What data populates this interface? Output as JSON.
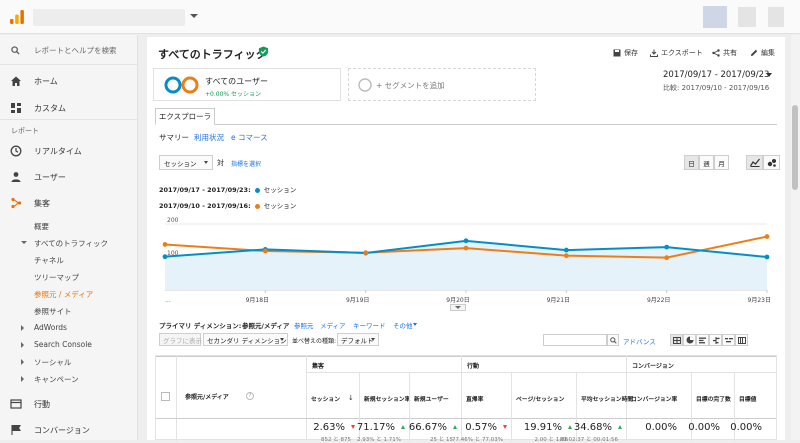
{
  "sidebar": {
    "search_placeholder": "レポートとヘルプを検索",
    "home": "ホーム",
    "custom": "カスタム",
    "reports_header": "レポート",
    "realtime": "リアルタイム",
    "audience": "ユーザー",
    "acquisition": "集客",
    "overview": "概要",
    "all_traffic": "すべてのトラフィック",
    "channels": "チャネル",
    "treemap": "ツリーマップ",
    "source_medium": "参照元 / メディア",
    "referrals": "参照サイト",
    "adwords": "AdWords",
    "search_console": "Search Console",
    "social": "ソーシャル",
    "campaigns": "キャンペーン",
    "behavior": "行動",
    "conversions": "コンバージョン"
  },
  "header": {
    "title": "すべてのトラフィック",
    "save": "保存",
    "export": "エクスポート",
    "share": "共有",
    "edit": "編集"
  },
  "segments": {
    "active_name": "すべてのユーザー",
    "active_pct": "+0.00% セッション",
    "add_label": "+ セグメントを追加"
  },
  "daterange": {
    "current": "2017/09/17 - 2017/09/23",
    "compare": "比較: 2017/09/10 - 2017/09/16"
  },
  "tabs": {
    "explorer": "エクスプローラ",
    "summary": "サマリー",
    "usage": "利用状況",
    "ecommerce": "e コマース"
  },
  "controls": {
    "metric_select": "セッション",
    "vs": "対",
    "select_metric": "指標を選択",
    "day": "日",
    "week": "週",
    "month": "月"
  },
  "chart_data": {
    "type": "line",
    "categories": [
      "",
      "9月18日",
      "9月19日",
      "9月20日",
      "9月21日",
      "9月22日",
      "9月23日"
    ],
    "ylim": [
      0,
      200
    ],
    "yticks": [
      "200",
      "100"
    ],
    "ellipsis": "...",
    "series": [
      {
        "name": "セッション",
        "period": "2017/09/17 - 2017/09/23:",
        "color": "#058dc7",
        "values": [
          101,
          123,
          112,
          149,
          121,
          130,
          100
        ]
      },
      {
        "name": "セッション",
        "period": "2017/09/10 - 2017/09/16:",
        "color": "#ed7e17",
        "values": [
          138,
          118,
          113,
          127,
          104,
          98,
          162
        ]
      }
    ]
  },
  "dimension_bar": {
    "label": "プライマリ ディメンション:",
    "active": "参照元/メディア",
    "options": [
      "参照元",
      "メディア",
      "キーワード",
      "その他"
    ],
    "plot_rows": "グラフに表示",
    "secondary": "セカンダリ ディメンション",
    "sort_type_label": "並べ替えの種類:",
    "sort_type": "デフォルト",
    "advanced": "アドバンス"
  },
  "table": {
    "dim_header": "参照元/メディア",
    "groups": [
      "集客",
      "行動",
      "コンバージョン"
    ],
    "cols": [
      {
        "label": "セッション",
        "value": "2.63%",
        "dir": "down",
        "sub": "852 と 875"
      },
      {
        "label": "新規セッション率",
        "value": "71.17%",
        "dir": "up",
        "sub": "2.93% と 1.71%"
      },
      {
        "label": "新規ユーザー",
        "value": "66.67%",
        "dir": "up",
        "sub": "25 と 15"
      },
      {
        "label": "直帰率",
        "value": "0.57%",
        "dir": "down",
        "sub": "77.46% と 77.03%"
      },
      {
        "label": "ページ/セッション",
        "value": "19.91%",
        "dir": "up",
        "sub": "2.00 と 1.66"
      },
      {
        "label": "平均セッション時間",
        "value": "34.68%",
        "dir": "up",
        "sub": "00:02:37 と 00:01:56"
      },
      {
        "label": "コンバージョン率",
        "value": "0.00%",
        "dir": "none",
        "sub": ""
      },
      {
        "label": "目標の完了数",
        "value": "0.00%",
        "dir": "none",
        "sub": ""
      },
      {
        "label": "目標値",
        "value": "0.00%",
        "dir": "none",
        "sub": ""
      }
    ]
  }
}
